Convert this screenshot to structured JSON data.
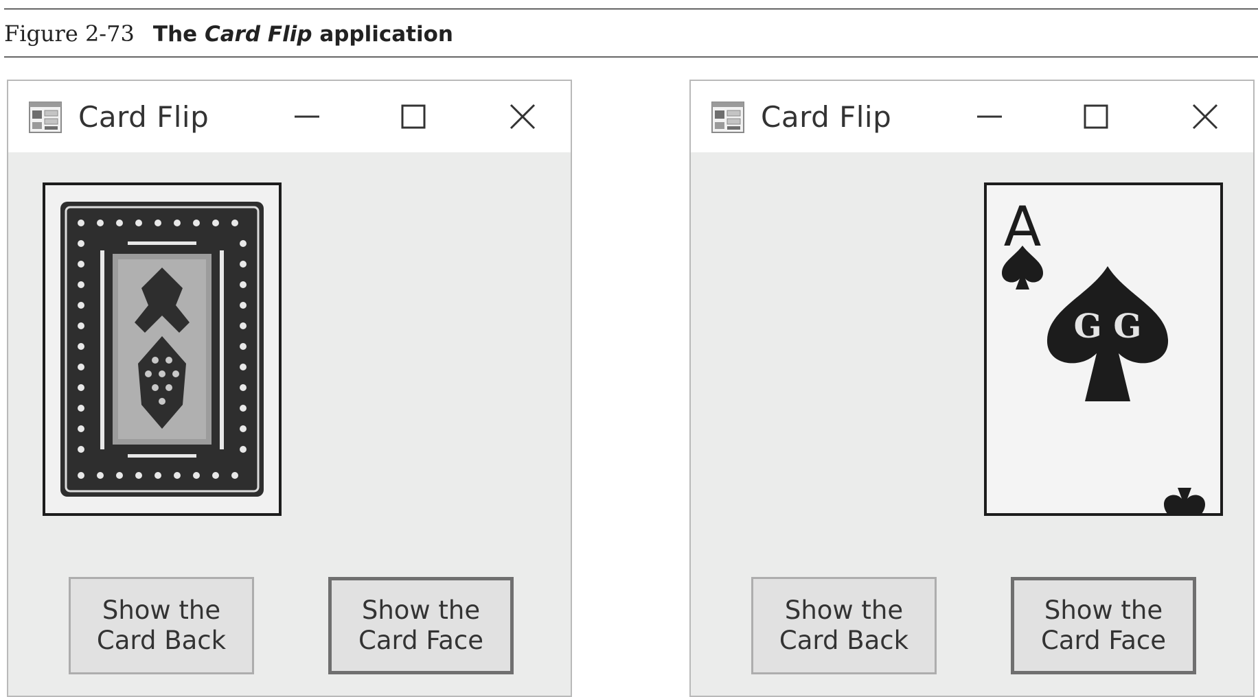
{
  "figure": {
    "number": "Figure 2-73",
    "title_prefix": "The ",
    "title_italic": "Card Flip",
    "title_suffix": " application"
  },
  "windows": [
    {
      "title": "Card Flip",
      "icon": "app-form-icon",
      "controls": {
        "minimize": "minimize-icon",
        "maximize": "maximize-icon",
        "close": "close-icon"
      },
      "card_shown": "back",
      "buttons": {
        "back": {
          "line1": "Show the",
          "line2": "Card Back"
        },
        "face": {
          "line1": "Show the",
          "line2": "Card Face"
        }
      },
      "default_button": "face"
    },
    {
      "title": "Card Flip",
      "icon": "app-form-icon",
      "controls": {
        "minimize": "minimize-icon",
        "maximize": "maximize-icon",
        "close": "close-icon"
      },
      "card_shown": "face",
      "card_face": {
        "rank": "A",
        "suit": "spades",
        "center_letters": "G G"
      },
      "buttons": {
        "back": {
          "line1": "Show the",
          "line2": "Card Back"
        },
        "face": {
          "line1": "Show the",
          "line2": "Card Face"
        }
      },
      "default_button": "face"
    }
  ],
  "colors": {
    "window_bg": "#ebeceb",
    "titlebar_bg": "#ffffff",
    "button_bg": "#e1e1e1",
    "card_ink": "#1c1c1c"
  }
}
